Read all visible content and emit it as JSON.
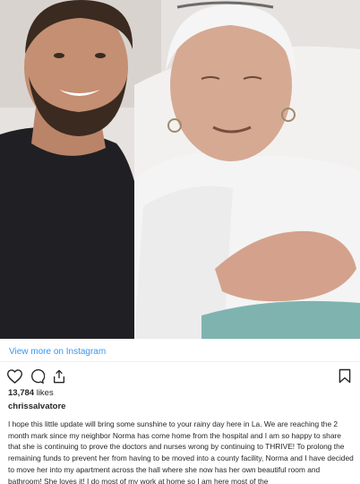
{
  "post": {
    "view_more": "View more on Instagram",
    "likes_count": "13,784",
    "likes_suffix": "likes",
    "username": "chrissalvatore",
    "caption": "I hope this little update will bring some sunshine to your rainy day here in La. We are reaching the 2 month mark since my neighbor Norma has come home from the hospital and I am so happy to share that she is continuing to prove the doctors and nurses wrong by continuing to THRIVE! To prolong the remaining funds to prevent her from having to be moved into a county facility, Norma and I have decided to move her into my apartment across the hall where she now has her own beautiful room and bathroom! She loves it! I do most of my work at home so I am here most of the"
  },
  "icons": {
    "like": "heart-icon",
    "comment": "comment-icon",
    "share": "share-icon",
    "save": "bookmark-icon"
  },
  "colors": {
    "link": "#3897f0",
    "text": "#262626",
    "divider": "#efefef"
  }
}
